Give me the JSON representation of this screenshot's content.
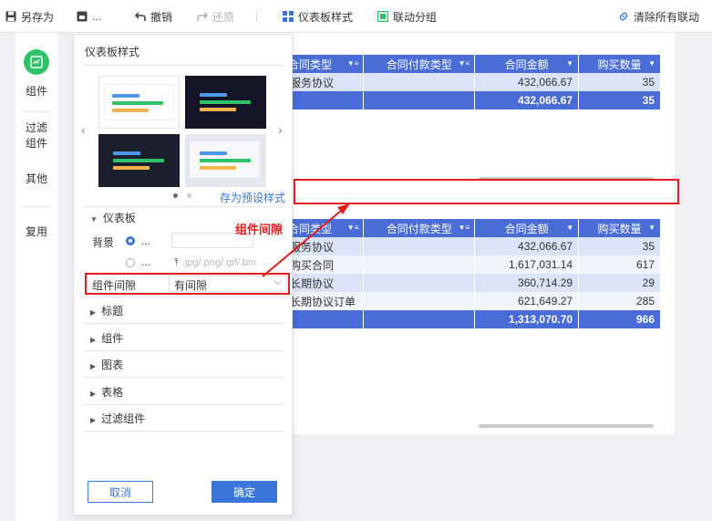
{
  "toolbar": {
    "save_as": "另存为",
    "more": "...",
    "undo": "撤销",
    "redo": "还原",
    "dashboard_style": "仪表板样式",
    "linkage_group": "联动分组",
    "clear_linkage": "清除所有联动"
  },
  "sidebar": {
    "widget": "组件",
    "filter_widget": [
      "过滤",
      "组件"
    ],
    "other": "其他",
    "reuse": "复用"
  },
  "table1": {
    "headers": [
      "合同类型",
      "合同付款类型",
      "合同金额",
      "购买数量"
    ],
    "rows": [
      [
        "服务协议",
        "",
        "432,066.67",
        "35"
      ]
    ],
    "total": [
      "",
      "",
      "432,066.67",
      "35"
    ]
  },
  "table2": {
    "headers": [
      "合同类型",
      "合同付款类型",
      "合同金额",
      "购买数量"
    ],
    "rows": [
      [
        "服务协议",
        "",
        "432,066.67",
        "35"
      ],
      [
        "购买合同",
        "",
        "1,617,031.14",
        "617"
      ],
      [
        "长期协议",
        "",
        "360,714.29",
        "29"
      ],
      [
        "长期协议订单",
        "",
        "621,649.27",
        "285"
      ]
    ],
    "total": [
      "",
      "",
      "1,313,070.70",
      "966"
    ]
  },
  "panel": {
    "title": "仪表板样式",
    "save_preset": "存为预设样式",
    "section_dashboard": "仪表板",
    "background_label": "背景",
    "option_ellipsis": "...",
    "upload_hint": ".jpg/.png/.gif/.bm",
    "gap_label": "组件间隙",
    "gap_value": "有间隙",
    "sections": [
      "标题",
      "组件",
      "图表",
      "表格",
      "过滤组件"
    ],
    "cancel": "取消",
    "confirm": "确定"
  },
  "annotation": {
    "label": "组件间隙"
  },
  "colors": {
    "accent": "#3a76d9",
    "table_header": "#4a6cd6",
    "annotation": "#e21d1d",
    "widget_icon": "#2ec26a"
  }
}
